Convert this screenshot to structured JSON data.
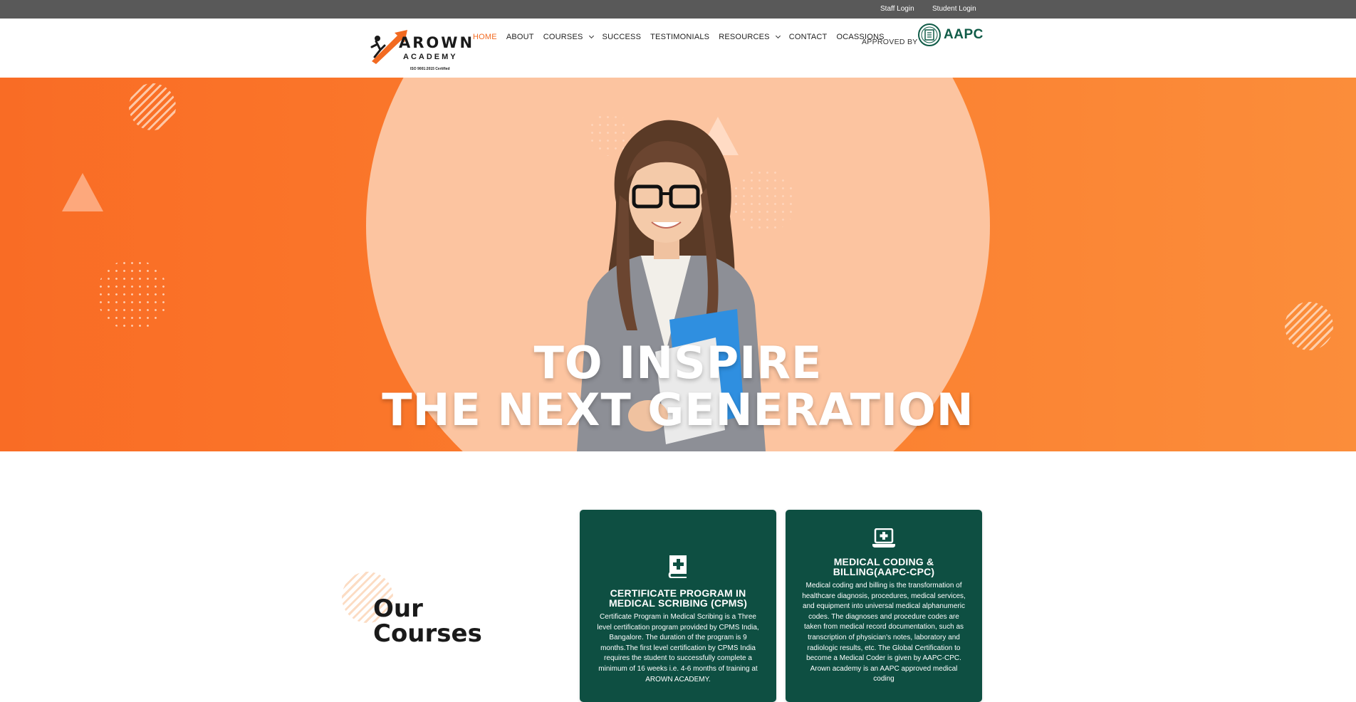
{
  "topbar": {
    "staff_login": "Staff Login",
    "student_login": "Student Login"
  },
  "logo": {
    "line1": "AROWN",
    "line2": "ACADEMY",
    "iso": "ISO 9001:2015 Certified"
  },
  "nav": {
    "items": [
      {
        "label": "HOME",
        "active": true,
        "dropdown": false
      },
      {
        "label": "ABOUT",
        "active": false,
        "dropdown": false
      },
      {
        "label": "COURSES",
        "active": false,
        "dropdown": true
      },
      {
        "label": "SUCCESS",
        "active": false,
        "dropdown": false
      },
      {
        "label": "TESTIMONIALS",
        "active": false,
        "dropdown": false
      },
      {
        "label": "RESOURCES",
        "active": false,
        "dropdown": true
      },
      {
        "label": "CONTACT",
        "active": false,
        "dropdown": false
      },
      {
        "label": "OCASSIONS",
        "active": false,
        "dropdown": false
      }
    ],
    "approved_by": "APPROVED BY",
    "partner": "AAPC"
  },
  "hero": {
    "line1": "TO INSPIRE",
    "line2": "THE NEXT GENERATION"
  },
  "courses": {
    "heading_line1": "Our",
    "heading_line2": "Courses",
    "cards": [
      {
        "icon": "medical-book-icon",
        "title": "CERTIFICATE PROGRAM IN MEDICAL SCRIBING (CPMS)",
        "body": "Certificate Program in Medical Scribing is a Three level certification program provided by CPMS India, Bangalore. The duration of the program is 9 months.The first level certification by CPMS India requires the student to successfully complete a minimum of 16 weeks i.e. 4-6 months of training at AROWN ACADEMY."
      },
      {
        "icon": "medical-laptop-icon",
        "title": "MEDICAL CODING & BILLING(AAPC-CPC)",
        "body": "Medical coding and billing is the transformation of healthcare diagnosis, procedures, medical services, and equipment into universal medical alphanumeric codes. The diagnoses and procedure codes are taken from medical record documentation, such as transcription of physician's notes, laboratory and radiologic results, etc. The Global Certification to become a Medical Coder is given by AAPC-CPC. Arown academy is an AAPC approved medical coding"
      }
    ]
  },
  "colors": {
    "accent": "#f26a21",
    "hero_orange": "#fb7a2c",
    "card_green": "#0e4f42",
    "topbar": "#595959"
  }
}
